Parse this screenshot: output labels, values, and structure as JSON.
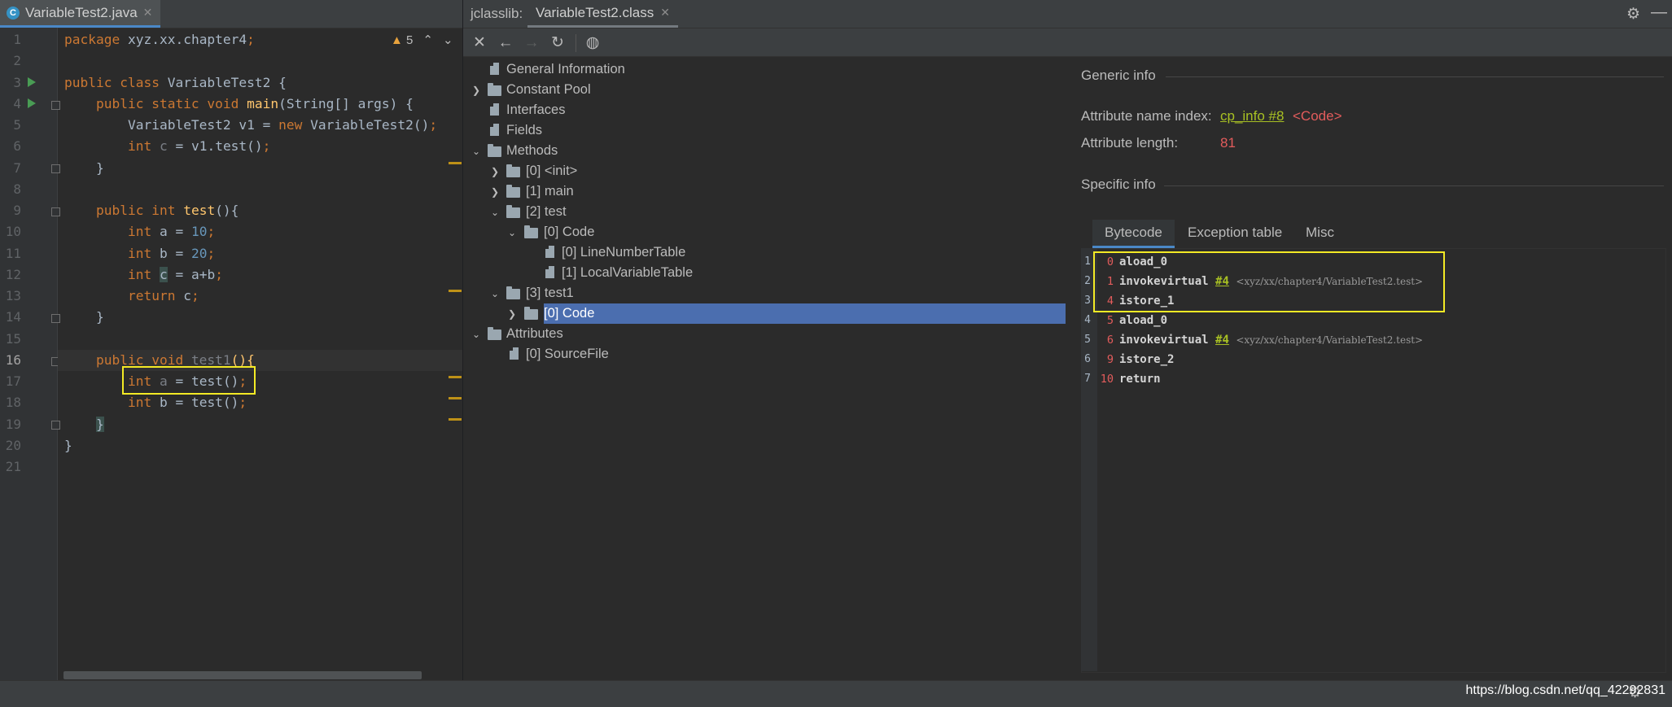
{
  "editor": {
    "tab_label": "VariableTest2.java",
    "warning_count": "5",
    "line_numbers": [
      "1",
      "2",
      "3",
      "4",
      "5",
      "6",
      "7",
      "8",
      "9",
      "10",
      "11",
      "12",
      "13",
      "14",
      "15",
      "16",
      "17",
      "18",
      "19",
      "20",
      "21"
    ],
    "code": {
      "l1_kw": "package",
      "l1_rest": " xyz.xx.chapter4",
      "l1_semi": ";",
      "l3_kw": "public class",
      "l3_rest": " VariableTest2 {",
      "l4_kw": "public static void",
      "l4_fn": "main",
      "l4_rest": "(String[] args) {",
      "l5_a": "VariableTest2 v1 = ",
      "l5_kw": "new",
      "l5_b": " VariableTest2()",
      "l5_semi": ";",
      "l6_kw": "int",
      "l6_var": "c",
      "l6_rest": " = v1.test()",
      "l6_semi": ";",
      "l7": "}",
      "l9_kw": "public int",
      "l9_fn": "test",
      "l9_rest": "(){",
      "l10_kw": "int",
      "l10_a": " a = ",
      "l10_num": "10",
      "l10_semi": ";",
      "l11_kw": "int",
      "l11_a": " b = ",
      "l11_num": "20",
      "l11_semi": ";",
      "l12_kw": "int",
      "l12_var": "c",
      "l12_rest": " = a+b",
      "l12_semi": ";",
      "l13_kw": "return",
      "l13_rest": " c",
      "l13_semi": ";",
      "l14": "}",
      "l16_kw": "public void",
      "l16_fn": "test1",
      "l16_rest": "(){",
      "l17_kw": "int",
      "l17_var": "a",
      "l17_rest": " = test()",
      "l17_semi": ";",
      "l18_kw": "int",
      "l18_rest": " b = test()",
      "l18_semi": ";",
      "l19": "}",
      "l20": "}"
    }
  },
  "jclasslib": {
    "label": "jclasslib:",
    "tab_label": "VariableTest2.class",
    "tree": {
      "general": "General Information",
      "constant_pool": "Constant Pool",
      "interfaces": "Interfaces",
      "fields": "Fields",
      "methods": "Methods",
      "m0": "[0] <init>",
      "m1": "[1] main",
      "m2": "[2] test",
      "m2_code": "[0] Code",
      "m2_lnt": "[0] LineNumberTable",
      "m2_lvt": "[1] LocalVariableTable",
      "m3": "[3] test1",
      "m3_code": "[0] Code",
      "attributes": "Attributes",
      "sourcefile": "[0] SourceFile"
    },
    "detail": {
      "generic_title": "Generic info",
      "name_index_label": "Attribute name index:",
      "name_index_link": "cp_info #8",
      "name_index_value": "<Code>",
      "length_label": "Attribute length:",
      "length_value": "81",
      "specific_title": "Specific info",
      "tabs": [
        "Bytecode",
        "Exception table",
        "Misc"
      ],
      "bytecode": [
        {
          "line": "1",
          "offset": "0",
          "op": "aload_0"
        },
        {
          "line": "2",
          "offset": "1",
          "op": "invokevirtual",
          "ref": "#4",
          "comment": "<xyz/xx/chapter4/VariableTest2.test>"
        },
        {
          "line": "3",
          "offset": "4",
          "op": "istore_1"
        },
        {
          "line": "4",
          "offset": "5",
          "op": "aload_0"
        },
        {
          "line": "5",
          "offset": "6",
          "op": "invokevirtual",
          "ref": "#4",
          "comment": "<xyz/xx/chapter4/VariableTest2.test>"
        },
        {
          "line": "6",
          "offset": "9",
          "op": "istore_2"
        },
        {
          "line": "7",
          "offset": "10",
          "op": "return"
        }
      ]
    }
  },
  "status": {
    "watermark": "https://blog.csdn.net/qq_42292831"
  }
}
